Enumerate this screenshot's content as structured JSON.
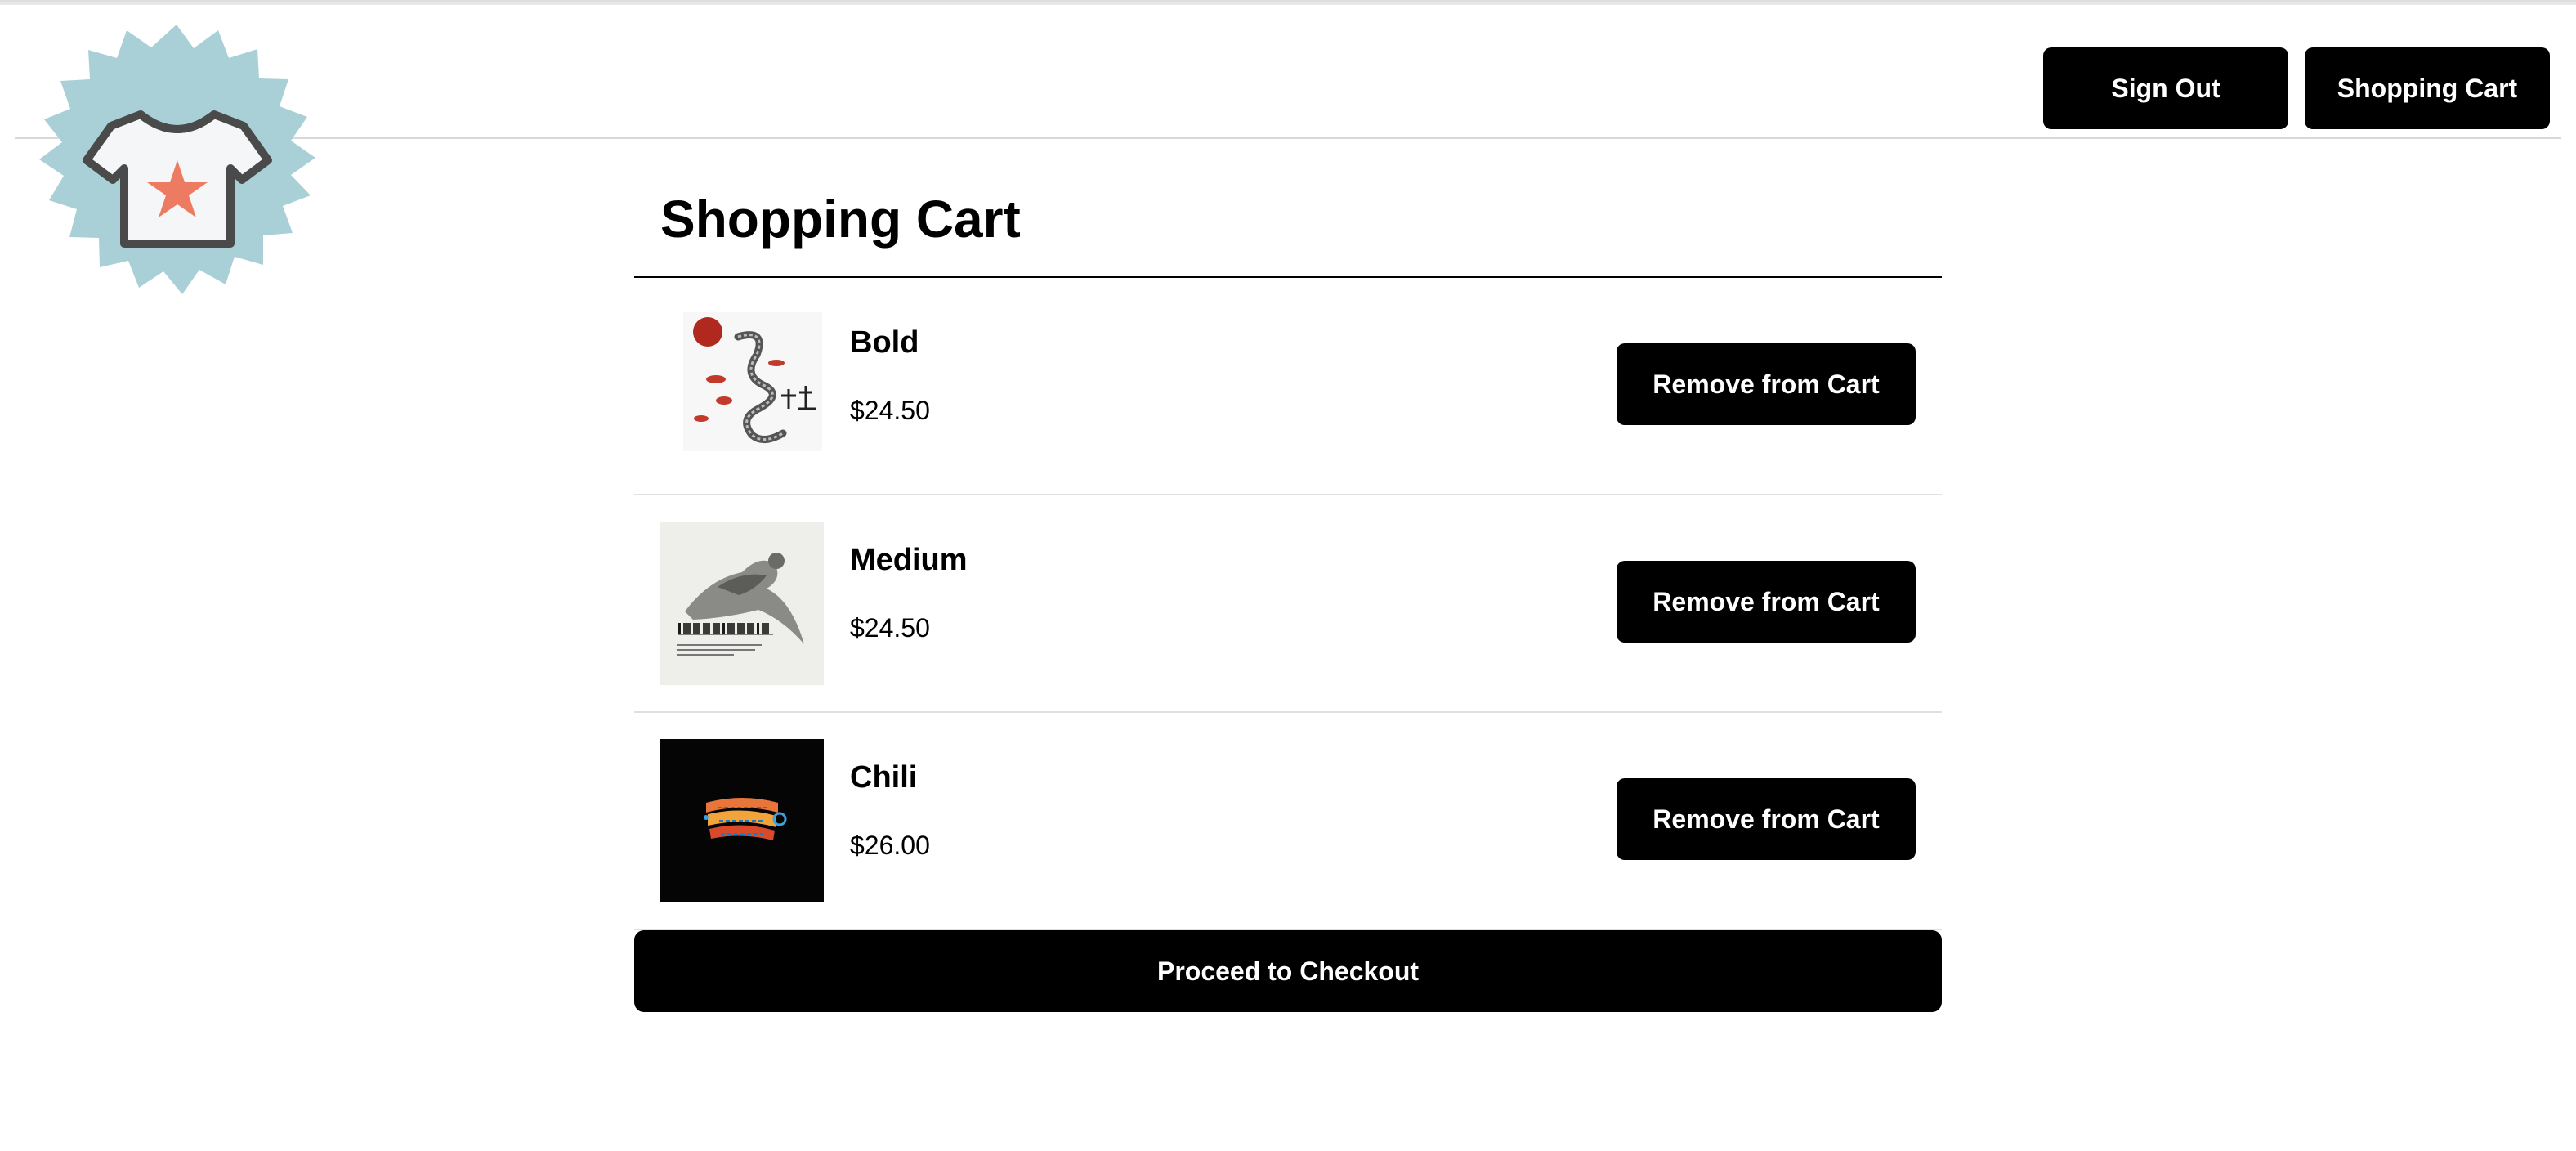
{
  "header": {
    "logo_icon": "tshirt-star-badge-icon",
    "sign_out_label": "Sign Out",
    "shopping_cart_label": "Shopping Cart"
  },
  "main": {
    "title": "Shopping Cart",
    "items": [
      {
        "name": "Bold",
        "price": "$24.50",
        "image": "dragon-print-tshirt-image",
        "remove_label": "Remove from Cart"
      },
      {
        "name": "Medium",
        "price": "$24.50",
        "image": "inspiration-print-tshirt-image",
        "remove_label": "Remove from Cart"
      },
      {
        "name": "Chili",
        "price": "$26.00",
        "image": "chili-print-tshirt-image",
        "remove_label": "Remove from Cart"
      }
    ],
    "checkout_label": "Proceed to Checkout"
  },
  "colors": {
    "button_bg": "#000000",
    "button_text": "#ffffff",
    "logo_badge": "#a9d0d7",
    "logo_star": "#ed7b61"
  }
}
